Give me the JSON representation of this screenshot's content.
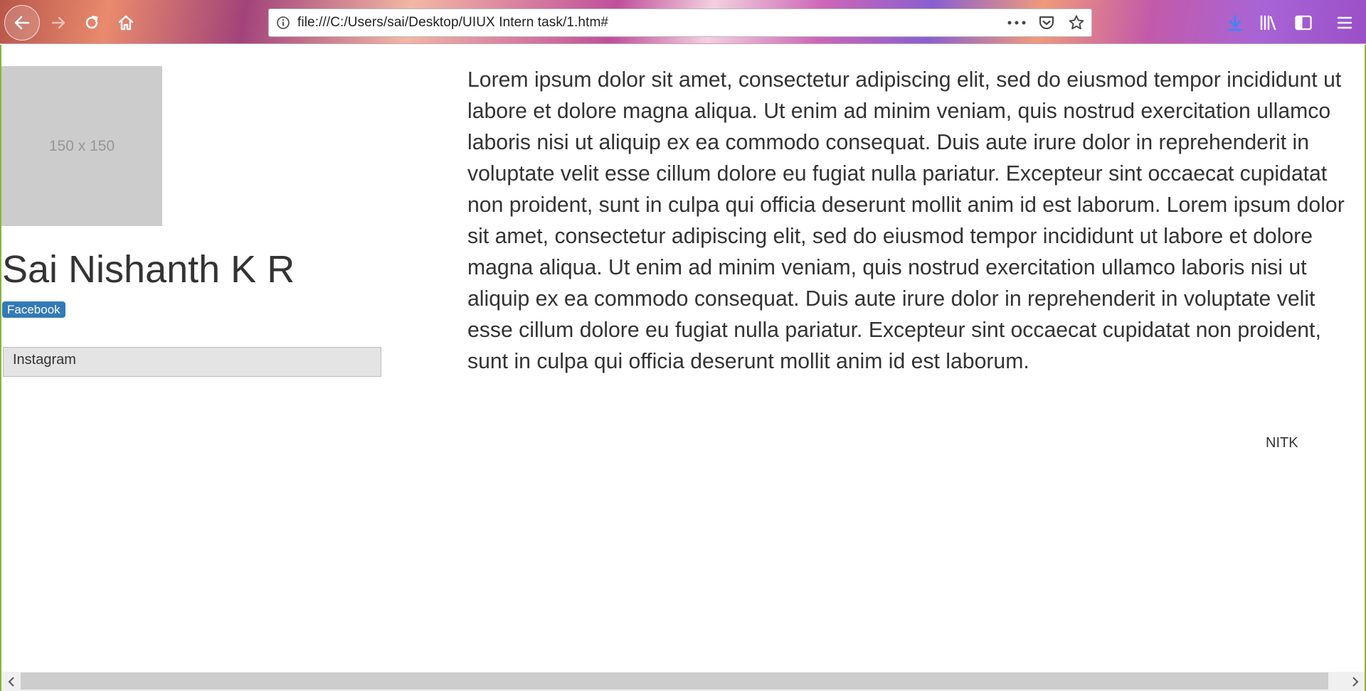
{
  "browser": {
    "url": "file:///C:/Users/sai/Desktop/UIUX Intern task/1.htm#",
    "icons": {
      "back": "back-arrow-icon",
      "forward": "forward-arrow-icon",
      "reload": "reload-icon",
      "home": "home-icon",
      "info": "info-icon",
      "more": "more-dots-icon",
      "pocket": "pocket-icon",
      "bookmark": "star-icon",
      "downloads": "download-icon",
      "library": "library-icon",
      "sidebar": "sidebar-icon",
      "menu": "hamburger-menu-icon"
    },
    "accent_color": "#4a90e2"
  },
  "profile": {
    "image_placeholder": "150 x 150",
    "name": "Sai Nishanth K R",
    "facebook_label": "Facebook",
    "instagram_label": "Instagram"
  },
  "main": {
    "paragraph": "Lorem ipsum dolor sit amet, consectetur adipiscing elit, sed do eiusmod tempor incididunt ut labore et dolore magna aliqua. Ut enim ad minim veniam, quis nostrud exercitation ullamco laboris nisi ut aliquip ex ea commodo consequat. Duis aute irure dolor in reprehenderit in voluptate velit esse cillum dolore eu fugiat nulla pariatur. Excepteur sint occaecat cupidatat non proident, sunt in culpa qui officia deserunt mollit anim id est laborum. Lorem ipsum dolor sit amet, consectetur adipiscing elit, sed do eiusmod tempor incididunt ut labore et dolore magna aliqua. Ut enim ad minim veniam, quis nostrud exercitation ullamco laboris nisi ut aliquip ex ea commodo consequat. Duis aute irure dolor in reprehenderit in voluptate velit esse cillum dolore eu fugiat nulla pariatur. Excepteur sint occaecat cupidatat non proident, sunt in culpa qui officia deserunt mollit anim id est laborum.",
    "footer": "NITK"
  },
  "colors": {
    "facebook_badge": "#337ab7",
    "placeholder_bg": "#cccccc"
  }
}
